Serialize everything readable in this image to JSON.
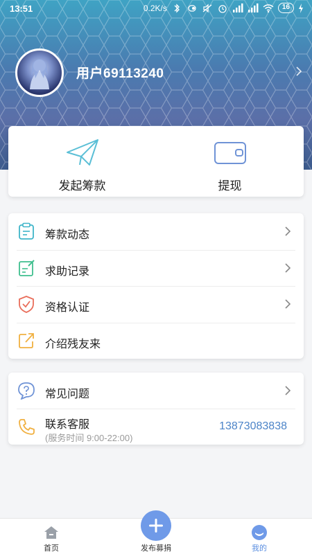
{
  "status_bar": {
    "time": "13:51",
    "network_speed": "0.2K/s",
    "battery": "16"
  },
  "profile": {
    "username": "用户69113240"
  },
  "quick_actions": [
    {
      "label": "发起筹款",
      "icon": "paper-plane-icon"
    },
    {
      "label": "提现",
      "icon": "wallet-icon"
    }
  ],
  "menu": [
    {
      "label": "筹款动态",
      "icon": "clipboard-icon",
      "color": "#3fb5c9"
    },
    {
      "label": "求助记录",
      "icon": "record-edit-icon",
      "color": "#3fbf8e"
    },
    {
      "label": "资格认证",
      "icon": "shield-check-icon",
      "color": "#e96d5a"
    },
    {
      "label": "介绍残友来",
      "icon": "share-icon",
      "color": "#f0b040"
    }
  ],
  "help": {
    "faq_label": "常见问题",
    "service_label": "联系客服",
    "service_hours": "(服务时间 9:00-22:00)",
    "phone": "13873083838"
  },
  "tabs": [
    {
      "label": "首页",
      "icon": "home-icon"
    },
    {
      "label": "发布募捐",
      "icon": "plus-icon"
    },
    {
      "label": "我的",
      "icon": "profile-icon"
    }
  ],
  "colors": {
    "accent": "#6f9ae8",
    "phone": "#4c84c8"
  }
}
